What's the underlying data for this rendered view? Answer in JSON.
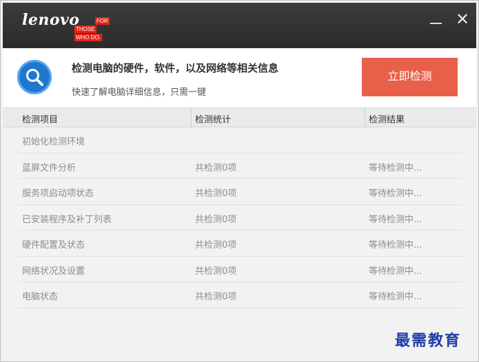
{
  "titlebar": {
    "brand": "lenovo",
    "slogan": [
      "FOR",
      "THOSE",
      "WHO DO."
    ],
    "minimize_glyph": "—",
    "close_glyph": "✕"
  },
  "header": {
    "title": "检测电脑的硬件，软件，以及网络等相关信息",
    "subtitle": "快速了解电脑详细信息，只需一键",
    "detect_button": "立即检测",
    "icon": "search-icon"
  },
  "table": {
    "columns": [
      "检测项目",
      "检测统计",
      "检测结果"
    ],
    "rows": [
      {
        "item": "初始化检测环境",
        "stat": "",
        "result": ""
      },
      {
        "item": "蓝屏文件分析",
        "stat": "共检测0项",
        "result": "等待检测中..."
      },
      {
        "item": "服务项启动项状态",
        "stat": "共检测0项",
        "result": "等待检测中..."
      },
      {
        "item": "已安装程序及补丁列表",
        "stat": "共检测0项",
        "result": "等待检测中..."
      },
      {
        "item": "硬件配置及状态",
        "stat": "共检测0项",
        "result": "等待检测中..."
      },
      {
        "item": "网络状况及设置",
        "stat": "共检测0项",
        "result": "等待检测中..."
      },
      {
        "item": "电脑状态",
        "stat": "共检测0项",
        "result": "等待检测中..."
      }
    ]
  },
  "watermark": "最需教育",
  "colors": {
    "titlebar": "#2f2f2f",
    "brand_red": "#e2231a",
    "accent_button": "#e8604a",
    "search_badge": "#1f77d0",
    "watermark": "#1e3aa8"
  }
}
